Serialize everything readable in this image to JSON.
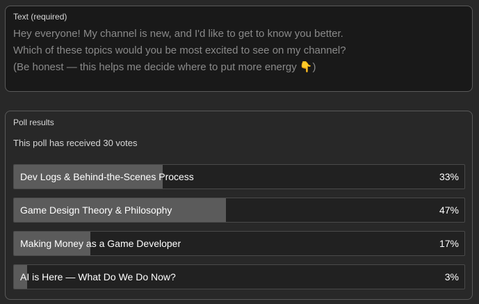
{
  "text_field": {
    "label": "Text (required)",
    "lines": [
      "Hey everyone! My channel is new, and I'd like to get to know you better.",
      "Which of these topics would you be most excited to see on my channel?",
      "(Be honest — this helps me decide where to put more energy 👇)"
    ]
  },
  "poll": {
    "label": "Poll results",
    "votes_text": "This poll has received 30 votes",
    "options": [
      {
        "label": "Dev Logs & Behind-the-Scenes Process",
        "percent_text": "33%",
        "percent": 33
      },
      {
        "label": "Game Design Theory & Philosophy",
        "percent_text": "47%",
        "percent": 47
      },
      {
        "label": "Making Money as a Game Developer",
        "percent_text": "17%",
        "percent": 17
      },
      {
        "label": "AI is Here — What Do We Do Now?",
        "percent_text": "3%",
        "percent": 3
      }
    ]
  },
  "colors": {
    "background": "#282828",
    "card_border": "#5a5a5a",
    "bar_fill": "#5b5b5b",
    "bar_track": "#212121"
  }
}
